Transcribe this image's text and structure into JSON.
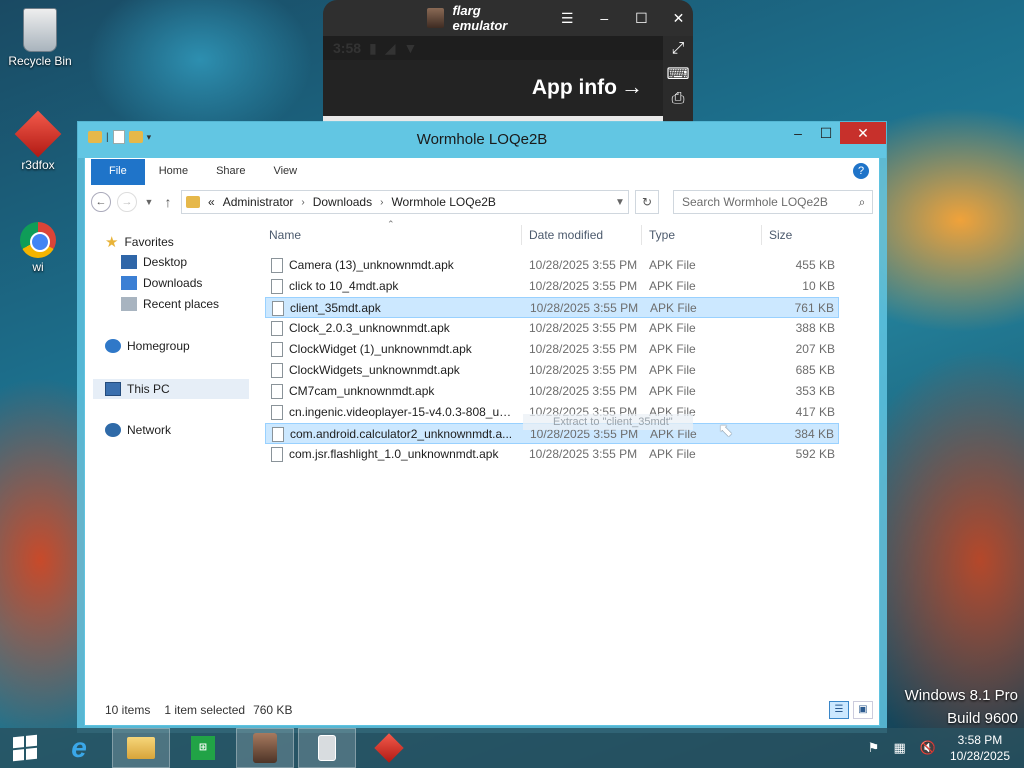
{
  "desktop": {
    "icons": [
      {
        "label": "Recycle Bin"
      },
      {
        "label": "r3dfox"
      },
      {
        "label": "wi"
      }
    ],
    "watermark": {
      "line1": "Windows 8.1 Pro",
      "line2": "Build 9600"
    }
  },
  "emulator": {
    "title": "flarg emulator",
    "status_time": "3:58",
    "app_title": "App info",
    "controls": {
      "menu": "☰",
      "minimize": "–",
      "maximize": "☐",
      "close": "✕"
    }
  },
  "explorer": {
    "title": "Wormhole LOQe2B",
    "ribbon_tabs": [
      "File",
      "Home",
      "Share",
      "View"
    ],
    "address": {
      "prefix": "«",
      "crumbs": [
        "Administrator",
        "Downloads",
        "Wormhole LOQe2B"
      ]
    },
    "search_placeholder": "Search Wormhole LOQe2B",
    "nav": {
      "favorites": "Favorites",
      "desktop": "Desktop",
      "downloads": "Downloads",
      "recent": "Recent places",
      "homegroup": "Homegroup",
      "thispc": "This PC",
      "network": "Network"
    },
    "columns": {
      "name": "Name",
      "date": "Date modified",
      "type": "Type",
      "size": "Size"
    },
    "files": [
      {
        "name": "Camera (13)_unknownmdt.apk",
        "date": "10/28/2025 3:55 PM",
        "type": "APK File",
        "size": "455 KB"
      },
      {
        "name": "click to 10_4mdt.apk",
        "date": "10/28/2025 3:55 PM",
        "type": "APK File",
        "size": "10 KB"
      },
      {
        "name": "client_35mdt.apk",
        "date": "10/28/2025 3:55 PM",
        "type": "APK File",
        "size": "761 KB"
      },
      {
        "name": "Clock_2.0.3_unknownmdt.apk",
        "date": "10/28/2025 3:55 PM",
        "type": "APK File",
        "size": "388 KB"
      },
      {
        "name": "ClockWidget (1)_unknownmdt.apk",
        "date": "10/28/2025 3:55 PM",
        "type": "APK File",
        "size": "207 KB"
      },
      {
        "name": "ClockWidgets_unknownmdt.apk",
        "date": "10/28/2025 3:55 PM",
        "type": "APK File",
        "size": "685 KB"
      },
      {
        "name": "CM7cam_unknownmdt.apk",
        "date": "10/28/2025 3:55 PM",
        "type": "APK File",
        "size": "353 KB"
      },
      {
        "name": "cn.ingenic.videoplayer-15-v4.0.3-808_un...",
        "date": "10/28/2025 3:55 PM",
        "type": "APK File",
        "size": "417 KB"
      },
      {
        "name": "com.android.calculator2_unknownmdt.a...",
        "date": "10/28/2025 3:55 PM",
        "type": "APK File",
        "size": "384 KB"
      },
      {
        "name": "com.jsr.flashlight_1.0_unknownmdt.apk",
        "date": "10/28/2025 3:55 PM",
        "type": "APK File",
        "size": "592 KB"
      }
    ],
    "drag_tip": "Extract to \"client_35mdt\"",
    "status": {
      "items": "10 items",
      "selected": "1 item selected",
      "size": "760 KB"
    }
  },
  "taskbar": {
    "clock_time": "3:58 PM",
    "clock_date": "10/28/2025"
  }
}
